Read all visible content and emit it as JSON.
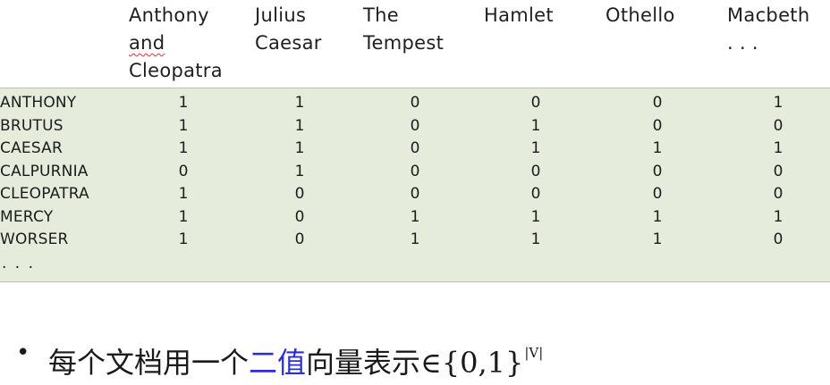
{
  "columns": [
    {
      "lines": [
        "Anthony",
        "and",
        "Cleopatra"
      ]
    },
    {
      "lines": [
        "Julius",
        "Caesar"
      ]
    },
    {
      "lines": [
        "The",
        "Tempest"
      ]
    },
    {
      "lines": [
        "Hamlet"
      ]
    },
    {
      "lines": [
        "Othello"
      ]
    },
    {
      "lines": [
        "Macbeth",
        ". . ."
      ]
    }
  ],
  "rows": [
    {
      "term": "ANTHONY",
      "values": [
        "1",
        "1",
        "0",
        "0",
        "0",
        "1"
      ]
    },
    {
      "term": "BRUTUS",
      "values": [
        "1",
        "1",
        "0",
        "1",
        "0",
        "0"
      ]
    },
    {
      "term": "CAESAR",
      "values": [
        "1",
        "1",
        "0",
        "1",
        "1",
        "1"
      ]
    },
    {
      "term": "CALPURNIA",
      "values": [
        "0",
        "1",
        "0",
        "0",
        "0",
        "0"
      ]
    },
    {
      "term": "CLEOPATRA",
      "values": [
        "1",
        "0",
        "0",
        "0",
        "0",
        "0"
      ]
    },
    {
      "term": "MERCY",
      "values": [
        "1",
        "0",
        "1",
        "1",
        "1",
        "1"
      ]
    },
    {
      "term": "WORSER",
      "values": [
        "1",
        "0",
        "1",
        "1",
        "1",
        "0"
      ]
    }
  ],
  "rows_ellipsis": ". . .",
  "bullet": {
    "marker": "•",
    "text_before": "每个文档用一个",
    "highlight": "二值",
    "text_after": "向量表示∈{0,1}",
    "superscript": "|V|",
    "highlight_color": "#2b2fd0"
  },
  "colors": {
    "matrix_bg": "#e6ecdc",
    "spellcheck_underline": "#d23b3b"
  }
}
